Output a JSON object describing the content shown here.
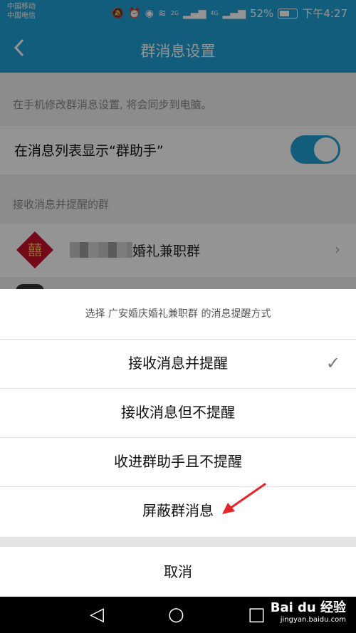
{
  "status_bar": {
    "carrier1": "中国移动",
    "carrier2": "中国电信",
    "net1": "2G",
    "net2": "4G",
    "battery": "52%",
    "time": "下午4:27",
    "icons": [
      "mute-icon",
      "alarm-icon",
      "eye-icon",
      "wifi-icon",
      "signal-icon",
      "signal-icon",
      "battery-icon"
    ]
  },
  "header": {
    "title": "群消息设置",
    "back_icon": "chevron-left-icon"
  },
  "page": {
    "hint": "在手机修改群消息设置, 将会同步到电脑。",
    "toggle_label": "在消息列表显示“群助手”",
    "toggle_on": true,
    "section_title": "接收消息并提醒的群",
    "group_name": "婚礼兼职群"
  },
  "sheet": {
    "title": "选择 广安婚庆婚礼兼职群 的消息提醒方式",
    "options": [
      {
        "label": "接收消息并提醒",
        "selected": true
      },
      {
        "label": "接收消息但不提醒",
        "selected": false
      },
      {
        "label": "收进群助手且不提醒",
        "selected": false
      },
      {
        "label": "屏蔽群消息",
        "selected": false
      }
    ],
    "cancel": "取消"
  },
  "nav": {
    "back": "◁",
    "home": "○",
    "recent": "□"
  },
  "watermark": {
    "main": "Bai du 经验",
    "sub": "jingyan.baidu.com"
  },
  "colors": {
    "accent": "#1f9fd6",
    "arrow": "#e8242b"
  }
}
